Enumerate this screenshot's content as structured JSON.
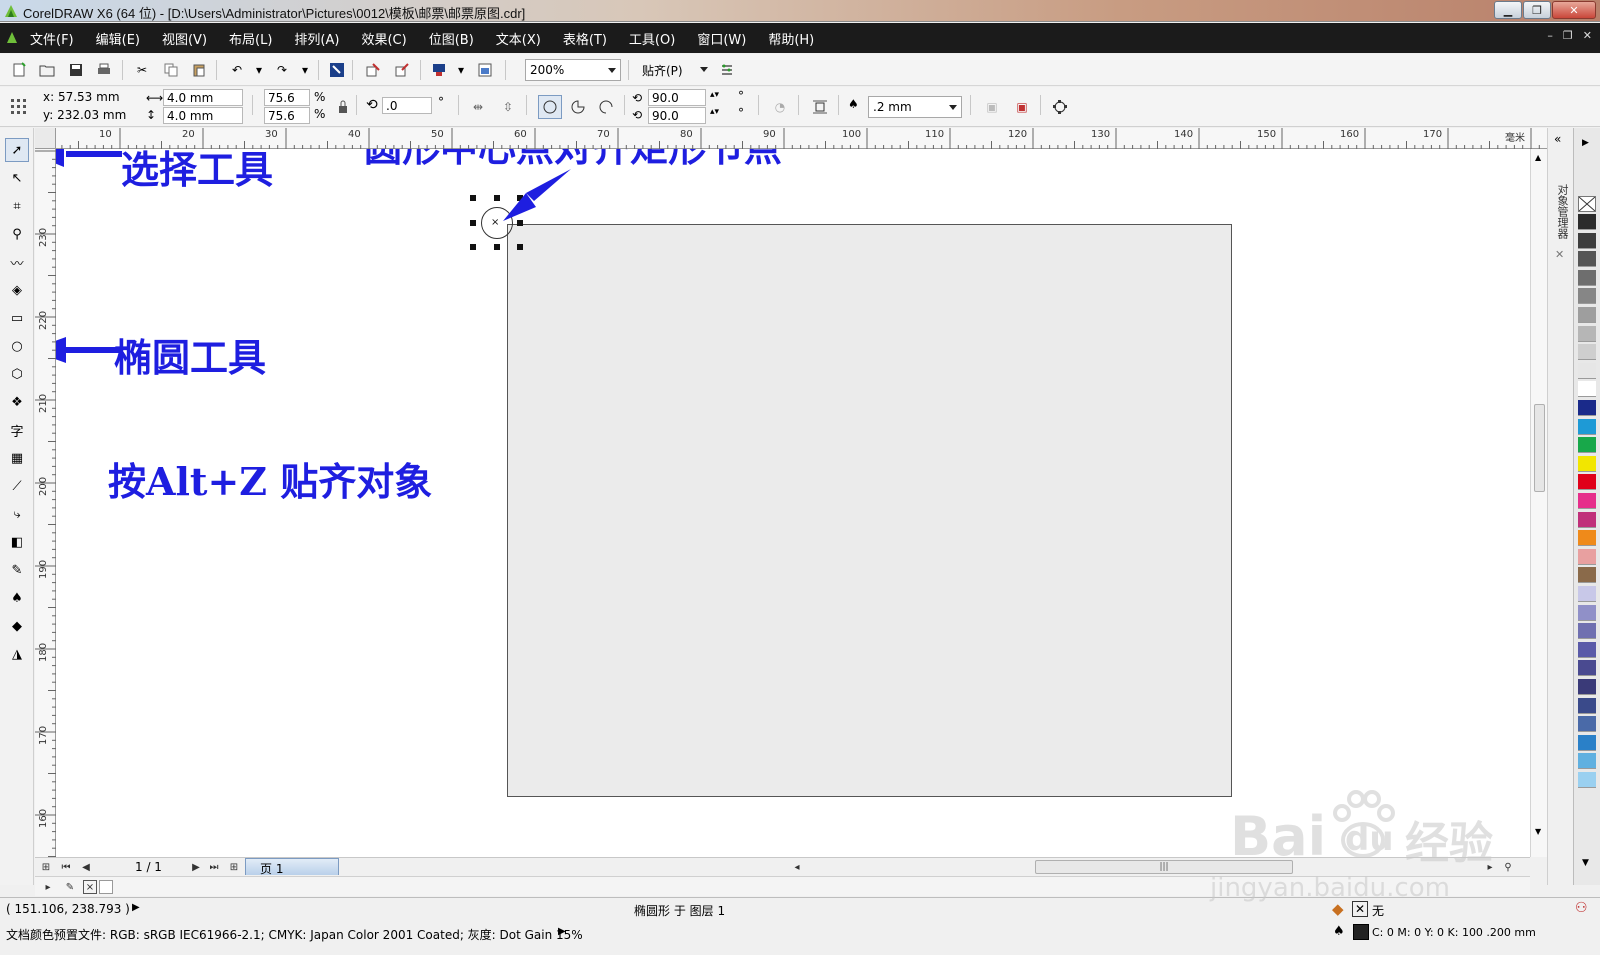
{
  "window": {
    "title": "CorelDRAW X6 (64 位) - [D:\\Users\\Administrator\\Pictures\\0012\\模板\\邮票\\邮票原图.cdr]"
  },
  "menu": {
    "items": [
      "文件(F)",
      "编辑(E)",
      "视图(V)",
      "布局(L)",
      "排列(A)",
      "效果(C)",
      "位图(B)",
      "文本(X)",
      "表格(T)",
      "工具(O)",
      "窗口(W)",
      "帮助(H)"
    ]
  },
  "toolbar": {
    "zoom": "200%",
    "snap_label": "贴齐(P)"
  },
  "property_bar": {
    "x": "x: 57.53 mm",
    "y": "y: 232.03 mm",
    "width": "4.0 mm",
    "height": "4.0 mm",
    "scale_x": "75.6",
    "scale_y": "75.6",
    "percent": "%",
    "rotation": ".0",
    "degree": "°",
    "start_angle": "90.0",
    "end_angle": "90.0",
    "outline_width": ".2 mm"
  },
  "ruler": {
    "h_ticks": [
      "10",
      "20",
      "30",
      "40",
      "50",
      "60",
      "70",
      "80",
      "90",
      "100",
      "110",
      "120",
      "130",
      "140",
      "150",
      "160",
      "170"
    ],
    "unit": "毫米",
    "v_ticks": [
      "230",
      "220",
      "210",
      "200",
      "190",
      "180",
      "170",
      "160"
    ]
  },
  "annotations": {
    "select_tool": "选择工具",
    "ellipse_tool": "椭圆工具",
    "center_align": "圆形中心点对齐矩形节点",
    "shortcut": "按Alt+Z 贴齐对象"
  },
  "page_nav": {
    "count": "1 / 1",
    "page_tab": "页 1"
  },
  "status": {
    "coords": "( 151.106, 238.793 )",
    "object_info": "椭圆形 于 图层 1",
    "color_profile": "文档颜色预置文件: RGB: sRGB IEC61966-2.1; CMYK: Japan Color 2001 Coated; 灰度: Dot Gain 15%",
    "fill": "无",
    "outline": "C: 0 M: 0 Y: 0 K: 100  .200 mm"
  },
  "docker": {
    "label": "对象管理器"
  },
  "watermark": {
    "brand": "Bai",
    "brand2": "du",
    "jingyan": "经验",
    "url": "jingyan.baidu.com"
  },
  "palette": {
    "colors": [
      "#2b2b2b",
      "#3d3d3d",
      "#555555",
      "#6e6e6e",
      "#868686",
      "#9e9e9e",
      "#b6b6b6",
      "#cecece",
      "#e6e6e6",
      "#ffffff",
      "#1a2a8a",
      "#1e9ad6",
      "#18a84a",
      "#f2e600",
      "#e0001a",
      "#e62e8b",
      "#c0307a",
      "#ef8a1a",
      "#e8a0a0",
      "#8a6a4a",
      "#c8c8e8",
      "#9090c8",
      "#7070b0",
      "#5a5aa8",
      "#4a4a90",
      "#3a3a78",
      "#3a4a8a",
      "#4a6aa8",
      "#2a80c8",
      "#60b0e0",
      "#9ad0f0"
    ]
  }
}
